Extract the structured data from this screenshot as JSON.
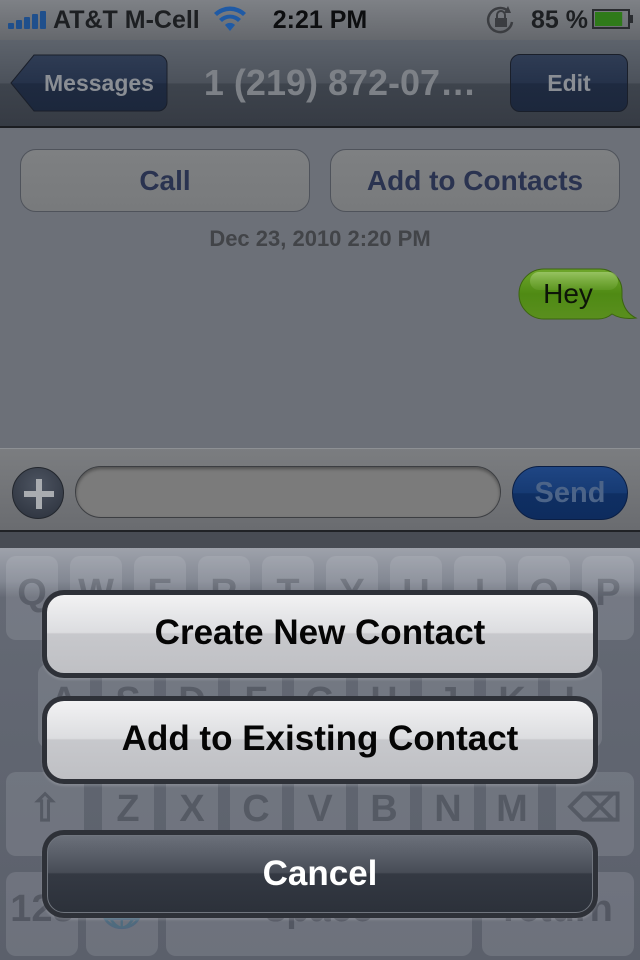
{
  "status_bar": {
    "carrier": "AT&T M-Cell",
    "time": "2:21 PM",
    "battery_percent": "85 %",
    "battery_level": 0.85,
    "signal_bars": 5,
    "icons": [
      "signal-bars-icon",
      "wifi-icon",
      "orientation-lock-icon",
      "battery-icon"
    ]
  },
  "nav_bar": {
    "back_label": "Messages",
    "title": "1 (219) 872-07…",
    "edit_label": "Edit"
  },
  "conversation": {
    "call_label": "Call",
    "add_to_contacts_label": "Add to Contacts",
    "timestamp": "Dec 23, 2010 2:20 PM",
    "messages": [
      {
        "text": "Hey",
        "direction": "outgoing"
      }
    ]
  },
  "input_bar": {
    "add_icon": "plus-icon",
    "input_value": "",
    "send_label": "Send"
  },
  "keyboard": {
    "row1": [
      "Q",
      "W",
      "E",
      "R",
      "T",
      "Y",
      "U",
      "I",
      "O",
      "P"
    ],
    "row2": [
      "A",
      "S",
      "D",
      "F",
      "G",
      "H",
      "J",
      "K",
      "L"
    ],
    "row3": [
      "Z",
      "X",
      "C",
      "V",
      "B",
      "N",
      "M"
    ],
    "bottom": {
      "numbers": "123",
      "space": "space",
      "return": "return"
    }
  },
  "action_sheet": {
    "create_new_contact": "Create New Contact",
    "add_to_existing_contact": "Add to Existing Contact",
    "cancel": "Cancel"
  },
  "colors": {
    "bubble_green": "#5a8f1e",
    "send_blue": "#163a73",
    "nav_button_blue": "#25324a"
  }
}
